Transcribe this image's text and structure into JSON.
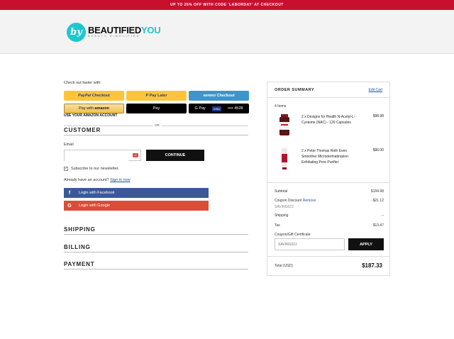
{
  "promo": {
    "text": "UP TO 25% OFF WITH CODE 'LABORDAY' AT CHECKOUT"
  },
  "brand": {
    "logo_mark": "by",
    "name_main": "BEAUTIFIED",
    "name_accent": "YOU",
    "tagline": "BEAUTY SIMPLIFIED"
  },
  "express": {
    "label": "Check out faster with:",
    "paypal": {
      "brand": "PayPal",
      "suffix": "Checkout"
    },
    "paylater": {
      "brand": "P",
      "suffix": "Pay Later"
    },
    "venmo": {
      "brand": "venmo",
      "suffix": "Checkout"
    },
    "amazon": {
      "prefix": "Pay with",
      "brand": "amazon"
    },
    "applepay": {
      "label": " Pay"
    },
    "gpay": {
      "label": "G Pay",
      "card_brand": "VISA",
      "card_digits": "•••• 4528"
    },
    "amazon_caption": "USE YOUR AMAZON ACCOUNT",
    "or_label": "OR"
  },
  "customer": {
    "title": "CUSTOMER",
    "email_label": "Email",
    "email_value": "",
    "continue_label": "CONTINUE",
    "subscribe_label": "Subscribe to our newsletter.",
    "account_prompt": "Already have an account?",
    "sign_in_label": "Sign in now",
    "facebook_label": "Login with Facebook",
    "google_label": "Login with Google",
    "facebook_icon": "f",
    "google_icon": "G"
  },
  "sections": {
    "shipping": "SHIPPING",
    "billing": "BILLING",
    "payment": "PAYMENT"
  },
  "order_summary": {
    "title": "ORDER SUMMARY",
    "edit_label": "Edit Cart",
    "items_count": "4 Items",
    "items": [
      {
        "name": "2 x Designs for Health N-Acetyl-L-Cysteine (NAC) - 120 Capsules",
        "price": "$98.98"
      },
      {
        "name": "2 x Peter Thomas Roth Even Smoother Microdermabrasion Exfoliating Pore Purifier",
        "price": "$96.00"
      }
    ],
    "subtotal_label": "Subtotal",
    "subtotal_value": "$194.98",
    "coupon_label": "Coupon Discount",
    "coupon_remove": "Remove",
    "coupon_value": "-$21.12",
    "coupon_code": "SAVING022",
    "shipping_label": "Shipping",
    "shipping_value": "--",
    "tax_label": "Tax",
    "tax_value": "$13.47",
    "gift_label": "Coupon/Gift Certificate",
    "gift_placeholder": "SAVING022",
    "apply_label": "APPLY",
    "total_label": "Total (USD)",
    "total_value": "$187.33"
  },
  "colors": {
    "promo_bg": "#c8102e",
    "brand_teal": "#1ec7cf",
    "facebook": "#3b5998",
    "google": "#dd4b39",
    "paypal_yellow": "#ffc439",
    "venmo_blue": "#3d95ce"
  }
}
